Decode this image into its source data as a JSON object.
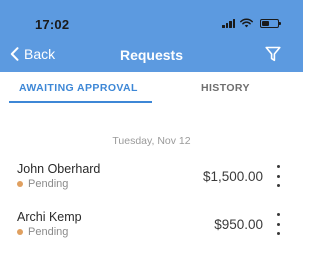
{
  "status_bar": {
    "time": "17:02",
    "icons": [
      "signal-icon",
      "wifi-icon",
      "battery-icon"
    ]
  },
  "nav": {
    "back_label": "Back",
    "title": "Requests",
    "filter_icon": "filter-icon"
  },
  "tabs": [
    {
      "label": "AWAITING APPROVAL",
      "active": true
    },
    {
      "label": "HISTORY",
      "active": false
    }
  ],
  "date_header": "Tuesday, Nov 12",
  "requests": [
    {
      "name": "John Oberhard",
      "status": "Pending",
      "amount": "$1,500.00"
    },
    {
      "name": "Archi Kemp",
      "status": "Pending",
      "amount": "$950.00"
    }
  ],
  "colors": {
    "header": "#5c9ae0",
    "accent": "#3d87d6",
    "pending_dot": "#e0a060"
  }
}
